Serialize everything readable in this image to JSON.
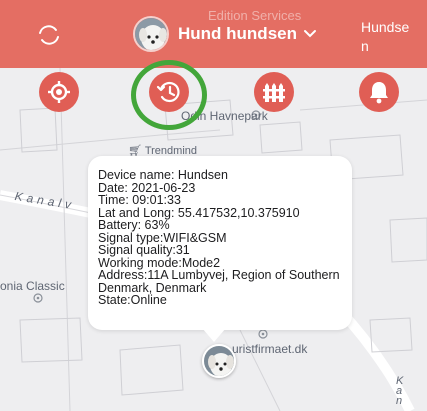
{
  "header": {
    "watermark_text": "Edition Services",
    "device_name": "Hund hundsen",
    "account_name": "Hundsen"
  },
  "actions": [
    {
      "name": "locate",
      "icon": "crosshair-icon"
    },
    {
      "name": "history",
      "icon": "clock-history-icon"
    },
    {
      "name": "fence",
      "icon": "fence-icon"
    },
    {
      "name": "alarm",
      "icon": "bell-icon"
    }
  ],
  "map": {
    "labels": {
      "park": "Odin Havnepark",
      "shop": "Trendmind",
      "road": "Kanalv",
      "place_left": "onia Classic",
      "business": "uristfirmaet.dk",
      "road_right": "Kan"
    }
  },
  "popup": {
    "lines": [
      "Device name: Hundsen",
      "Date: 2021-06-23",
      "Time: 09:01:33",
      "Lat and Long: 55.417532,10.375910",
      "Battery: 63%",
      "Signal type:WIFI&GSM",
      "Signal quality:31",
      "Working mode:Mode2",
      "Address:11A Lumbyvej, Region of Southern",
      "Denmark, Denmark",
      "State:Online"
    ]
  },
  "colors": {
    "header": "#e46e63",
    "action_button": "#e05e55",
    "highlight": "#43a63a"
  }
}
